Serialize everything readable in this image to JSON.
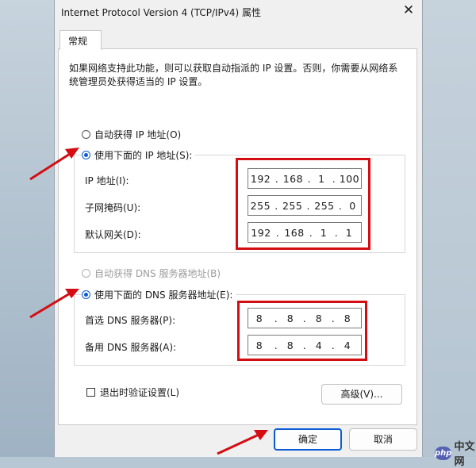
{
  "window": {
    "title": "Internet Protocol Version 4 (TCP/IPv4) 属性",
    "close_glyph": "✕"
  },
  "tabs": [
    {
      "label": "常规"
    }
  ],
  "description": "如果网络支持此功能，则可以获取自动指派的 IP 设置。否则，你需要从网络系统管理员处获得适当的 IP 设置。",
  "ip_section": {
    "auto_label": "自动获得 IP 地址(O)",
    "manual_label": "使用下面的 IP 地址(S):",
    "selected": "manual",
    "fields": [
      {
        "label": "IP 地址(I):",
        "octets": [
          "192",
          "168",
          "1",
          "100"
        ]
      },
      {
        "label": "子网掩码(U):",
        "octets": [
          "255",
          "255",
          "255",
          "0"
        ]
      },
      {
        "label": "默认网关(D):",
        "octets": [
          "192",
          "168",
          "1",
          "1"
        ]
      }
    ]
  },
  "dns_section": {
    "auto_label": "自动获得 DNS 服务器地址(B)",
    "manual_label": "使用下面的 DNS 服务器地址(E):",
    "selected": "manual",
    "fields": [
      {
        "label": "首选 DNS 服务器(P):",
        "octets": [
          "8",
          "8",
          "8",
          "8"
        ]
      },
      {
        "label": "备用 DNS 服务器(A):",
        "octets": [
          "8",
          "8",
          "4",
          "4"
        ]
      }
    ]
  },
  "validate_checkbox": {
    "label": "退出时验证设置(L)",
    "checked": false
  },
  "buttons": {
    "advanced": "高级(V)...",
    "ok": "确定",
    "cancel": "取消"
  },
  "watermark": {
    "logo": "php",
    "text": "中文网"
  },
  "colors": {
    "annotation_red": "#d40d12",
    "accent_blue": "#0a5bd3"
  }
}
